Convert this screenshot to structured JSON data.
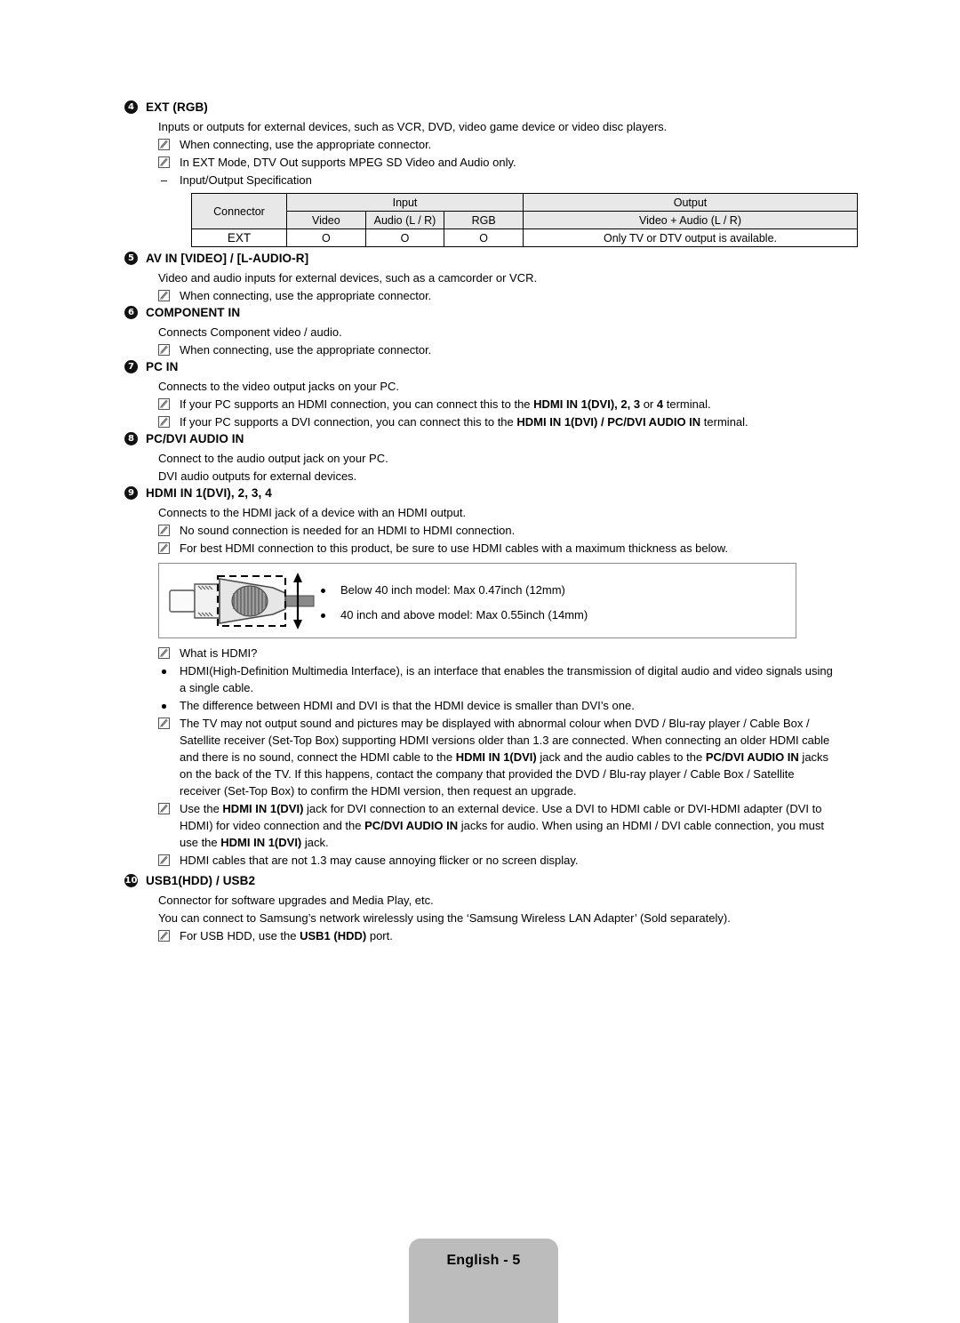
{
  "page": {
    "footer_label": "English - 5"
  },
  "sections": [
    {
      "number": "4",
      "title": "EXT (RGB)",
      "intro": "Inputs or outputs for external devices, such as VCR, DVD, video game device or video disc players.",
      "notes": [
        "When connecting, use the appropriate connector.",
        "In EXT Mode, DTV Out supports MPEG SD Video and Audio only."
      ],
      "dash_item": "Input/Output Specification"
    },
    {
      "number": "5",
      "title": "AV IN [VIDEO] / [L-AUDIO-R]",
      "intro": "Video and audio inputs for external devices, such as a camcorder or VCR.",
      "notes": [
        "When connecting, use the appropriate connector."
      ]
    },
    {
      "number": "6",
      "title": "COMPONENT IN",
      "intro": "Connects Component video / audio.",
      "notes": [
        "When connecting, use the appropriate connector."
      ]
    },
    {
      "number": "7",
      "title": "PC IN",
      "intro": "Connects to the video output jacks on your PC.",
      "notes": [
        "If your PC supports an HDMI connection, you can connect this to the HDMI IN 1(DVI), 2, 3 or 4 terminal.",
        "If your PC supports a DVI connection, you can connect this to the HDMI IN 1(DVI) / PC/DVI AUDIO IN terminal."
      ]
    },
    {
      "number": "8",
      "title": "PC/DVI AUDIO IN",
      "intro": "Connect to the audio output jack on your PC.",
      "intro2": "DVI audio outputs for external devices."
    },
    {
      "number": "9",
      "title": "HDMI IN 1(DVI), 2, 3, 4",
      "intro": "Connects to the HDMI jack of a device with an HDMI output.",
      "notes": [
        "No sound connection is needed for an HDMI to HDMI connection.",
        "For best HDMI connection to this product, be sure to use HDMI cables with a maximum thickness as below."
      ]
    },
    {
      "number": "10",
      "title": "USB1(HDD) / USB2",
      "intro": "Connector for software upgrades and Media Play, etc.",
      "intro2": "You can connect to Samsung’s network wirelessly using the ‘Samsung Wireless LAN Adapter’ (Sold separately).",
      "notes_final": [
        "For USB HDD, use the USB1 (HDD) port."
      ]
    }
  ],
  "spec_table": {
    "headers_row1": [
      "Connector",
      "Input",
      "Output"
    ],
    "headers_row2": [
      "Video",
      "Audio (L / R)",
      "RGB",
      "Video + Audio (L / R)"
    ],
    "rows": [
      {
        "connector": "EXT",
        "video": "O",
        "audio": "O",
        "rgb": "O",
        "output": "Only TV or DTV output is available."
      }
    ]
  },
  "cable_figure": {
    "items": [
      "Below 40 inch model: Max 0.47inch (12mm)",
      "40 inch and above model: Max 0.55inch (14mm)"
    ]
  },
  "hdmi_info": {
    "what_is": "What is HDMI?",
    "bullets": [
      "HDMI(High-Definition Multimedia Interface), is an interface that enables the transmission of digital audio and video signals using a single cable.",
      "The difference between HDMI and DVI is that the HDMI device is smaller than DVI’s one."
    ],
    "note_long_1_a": "The TV may not output sound and pictures may be displayed with abnormal colour when DVD / Blu-ray player / Cable Box / Satellite receiver (Set-Top Box) supporting HDMI versions older than 1.3 are connected. When connecting an older HDMI cable and there is no sound, connect the HDMI cable to the ",
    "note_long_1_b1": "HDMI IN 1(DVI)",
    "note_long_1_c": " jack and the audio cables to the ",
    "note_long_1_b2": "PC/DVI AUDIO IN",
    "note_long_1_d": " jacks on the back of the TV. If this happens, contact the company that provided the DVD / Blu-ray player / Cable Box / Satellite receiver (Set-Top Box) to confirm the HDMI version, then request an upgrade.",
    "note_long_2_a": "Use the ",
    "note_long_2_b1": "HDMI IN 1(DVI)",
    "note_long_2_c": " jack for DVI connection to an external device. Use a DVI to HDMI cable or DVI-HDMI adapter (DVI to HDMI) for video connection and the ",
    "note_long_2_b2": "PC/DVI AUDIO IN",
    "note_long_2_d": " jacks for audio. When using an HDMI / DVI cable connection, you must use the ",
    "note_long_2_b3": "HDMI IN 1(DVI)",
    "note_long_2_e": " jack.",
    "note_flicker": "HDMI cables that are not 1.3 may cause annoying flicker or no screen display."
  },
  "pc_in_notes": {
    "n1_a": "If your PC supports an HDMI connection, you can connect this to the ",
    "n1_b1": "HDMI IN 1",
    "n1_b1b": "(DVI), 2, 3",
    "n1_c": " or ",
    "n1_b2": "4",
    "n1_d": " terminal.",
    "n2_a": "If your PC supports a DVI connection, you can connect this to the ",
    "n2_b": "HDMI IN 1(DVI) / PC/DVI AUDIO IN",
    "n2_c": " terminal."
  },
  "usb_note": {
    "a": "For USB HDD, use the ",
    "b": "USB1 (HDD)",
    "c": " port."
  }
}
